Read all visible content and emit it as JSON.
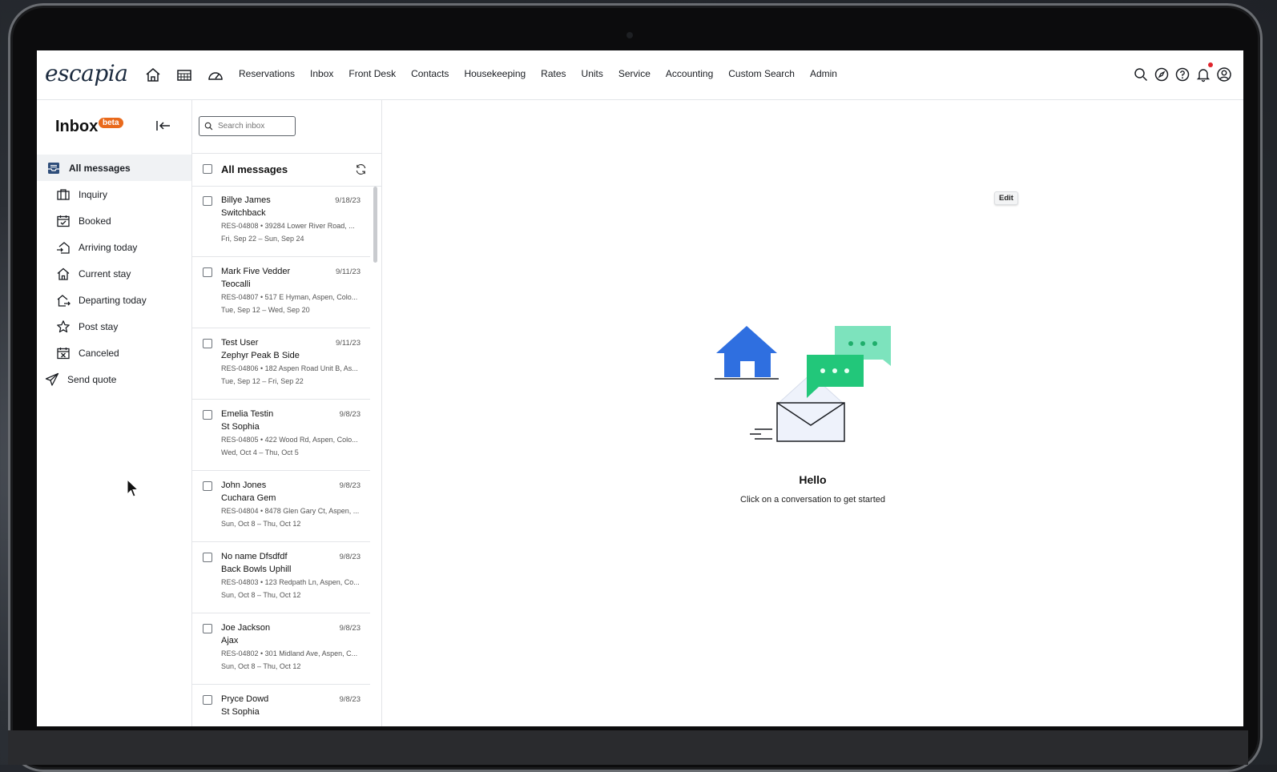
{
  "app": {
    "logo": "escapia"
  },
  "nav": {
    "links": [
      "Reservations",
      "Inbox",
      "Front Desk",
      "Contacts",
      "Housekeeping",
      "Rates",
      "Units",
      "Service",
      "Accounting",
      "Custom Search",
      "Admin"
    ]
  },
  "sidebar": {
    "title": "Inbox",
    "badge": "beta",
    "items": [
      {
        "label": "All messages",
        "icon": "inbox-icon"
      },
      {
        "label": "Inquiry",
        "icon": "suitcase-icon"
      },
      {
        "label": "Booked",
        "icon": "calendar-check-icon"
      },
      {
        "label": "Arriving today",
        "icon": "house-arrive-icon"
      },
      {
        "label": "Current stay",
        "icon": "house-icon"
      },
      {
        "label": "Departing today",
        "icon": "house-depart-icon"
      },
      {
        "label": "Post stay",
        "icon": "star-icon"
      },
      {
        "label": "Canceled",
        "icon": "calendar-x-icon"
      },
      {
        "label": "Send quote",
        "icon": "paper-plane-icon"
      }
    ]
  },
  "list": {
    "search_placeholder": "Search inbox",
    "header": "All messages",
    "messages": [
      {
        "name": "Billye James",
        "date": "9/18/23",
        "property": "Switchback",
        "res": "RES-04808 • 39284 Lower River Road, ...",
        "dates": "Fri, Sep 22 – Sun, Sep 24"
      },
      {
        "name": "Mark Five Vedder",
        "date": "9/11/23",
        "property": "Teocalli",
        "res": "RES-04807 • 517 E Hyman, Aspen, Colo...",
        "dates": "Tue, Sep 12 – Wed, Sep 20"
      },
      {
        "name": "Test User",
        "date": "9/11/23",
        "property": "Zephyr Peak B Side",
        "res": "RES-04806 • 182 Aspen Road Unit B, As...",
        "dates": "Tue, Sep 12 – Fri, Sep 22"
      },
      {
        "name": "Emelia Testin",
        "date": "9/8/23",
        "property": "St Sophia",
        "res": "RES-04805 • 422 Wood Rd, Aspen, Colo...",
        "dates": "Wed, Oct 4 – Thu, Oct 5"
      },
      {
        "name": "John Jones",
        "date": "9/8/23",
        "property": "Cuchara Gem",
        "res": "RES-04804 • 8478 Glen Gary Ct, Aspen, ...",
        "dates": "Sun, Oct 8 – Thu, Oct 12"
      },
      {
        "name": "No name Dfsdfdf",
        "date": "9/8/23",
        "property": "Back Bowls Uphill",
        "res": "RES-04803 • 123 Redpath Ln, Aspen, Co...",
        "dates": "Sun, Oct 8 – Thu, Oct 12"
      },
      {
        "name": "Joe Jackson",
        "date": "9/8/23",
        "property": "Ajax",
        "res": "RES-04802 • 301 Midland Ave, Aspen, C...",
        "dates": "Sun, Oct 8 – Thu, Oct 12"
      },
      {
        "name": "Pryce Dowd",
        "date": "9/8/23",
        "property": "St Sophia",
        "res": "",
        "dates": ""
      }
    ]
  },
  "main": {
    "edit_label": "Edit",
    "hello": "Hello",
    "hello_sub": "Click on a conversation to get started"
  },
  "colors": {
    "accent_blue": "#2f6fe0",
    "bubble_green": "#22c77a",
    "bubble_mint": "#7de3bd",
    "beta_orange": "#e96a1c",
    "notification_red": "#e0242c"
  }
}
